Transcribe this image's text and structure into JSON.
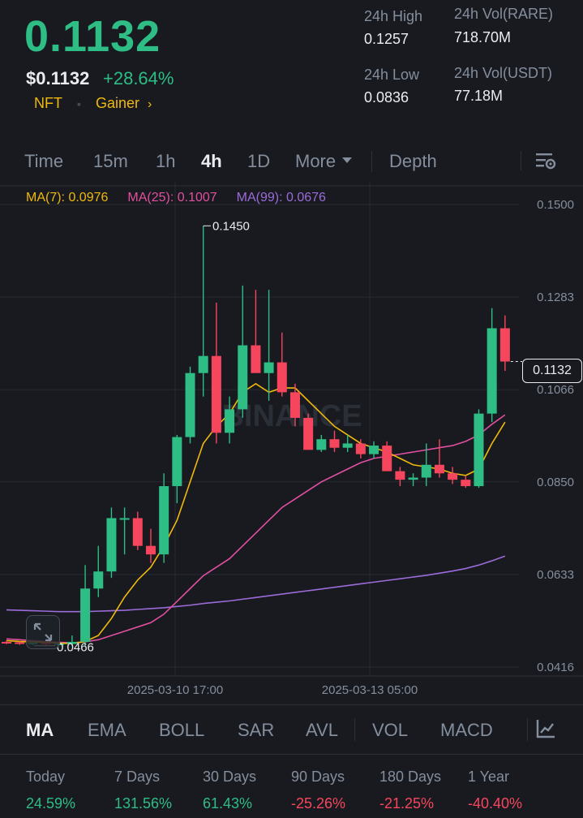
{
  "header": {
    "last_price": "0.1132",
    "price_usd": "$0.1132",
    "change_pct": "+28.64%",
    "tag_category": "NFT",
    "tag_rank": "Gainer",
    "high_label": "24h High",
    "high_value": "0.1257",
    "low_label": "24h Low",
    "low_value": "0.0836",
    "vol_base_label": "24h Vol(RARE)",
    "vol_base_value": "718.70M",
    "vol_quote_label": "24h Vol(USDT)",
    "vol_quote_value": "77.18M"
  },
  "intervals": {
    "time": "Time",
    "m15": "15m",
    "h1": "1h",
    "h4": "4h",
    "d1": "1D",
    "more": "More",
    "depth": "Depth"
  },
  "ma_legend": {
    "ma7": "MA(7): 0.0976",
    "ma25": "MA(25): 0.1007",
    "ma99": "MA(99): 0.0676"
  },
  "chart_data": {
    "type": "candlestick",
    "y_ticks": [
      "0.1500",
      "0.1283",
      "0.1066",
      "0.0850",
      "0.0633",
      "0.0416"
    ],
    "ylim": [
      0.0416,
      0.15
    ],
    "x_ticks": [
      "2025-03-10 17:00",
      "2025-03-13 05:00"
    ],
    "watermark": "BINANCE",
    "high_marker": "0.1450",
    "low_marker": "0.0466",
    "current_price": "0.1132",
    "candles": [
      {
        "o": 0.0475,
        "h": 0.0478,
        "l": 0.047,
        "c": 0.0474
      },
      {
        "o": 0.0474,
        "h": 0.0476,
        "l": 0.0468,
        "c": 0.0472
      },
      {
        "o": 0.0472,
        "h": 0.0475,
        "l": 0.0467,
        "c": 0.0473
      },
      {
        "o": 0.0473,
        "h": 0.0476,
        "l": 0.0466,
        "c": 0.047
      },
      {
        "o": 0.047,
        "h": 0.0474,
        "l": 0.0468,
        "c": 0.0471
      },
      {
        "o": 0.047,
        "h": 0.049,
        "l": 0.0466,
        "c": 0.0475
      },
      {
        "o": 0.0475,
        "h": 0.0655,
        "l": 0.0466,
        "c": 0.06
      },
      {
        "o": 0.06,
        "h": 0.07,
        "l": 0.058,
        "c": 0.064
      },
      {
        "o": 0.064,
        "h": 0.079,
        "l": 0.0625,
        "c": 0.0765
      },
      {
        "o": 0.0765,
        "h": 0.079,
        "l": 0.068,
        "c": 0.0765
      },
      {
        "o": 0.0765,
        "h": 0.078,
        "l": 0.069,
        "c": 0.07
      },
      {
        "o": 0.07,
        "h": 0.074,
        "l": 0.066,
        "c": 0.068
      },
      {
        "o": 0.068,
        "h": 0.087,
        "l": 0.066,
        "c": 0.084
      },
      {
        "o": 0.084,
        "h": 0.096,
        "l": 0.08,
        "c": 0.0955
      },
      {
        "o": 0.0955,
        "h": 0.112,
        "l": 0.094,
        "c": 0.1105
      },
      {
        "o": 0.1105,
        "h": 0.145,
        "l": 0.105,
        "c": 0.1145
      },
      {
        "o": 0.1145,
        "h": 0.127,
        "l": 0.094,
        "c": 0.0965
      },
      {
        "o": 0.0965,
        "h": 0.105,
        "l": 0.094,
        "c": 0.102
      },
      {
        "o": 0.102,
        "h": 0.131,
        "l": 0.1,
        "c": 0.117
      },
      {
        "o": 0.117,
        "h": 0.13,
        "l": 0.112,
        "c": 0.1105
      },
      {
        "o": 0.1105,
        "h": 0.13,
        "l": 0.104,
        "c": 0.113
      },
      {
        "o": 0.113,
        "h": 0.12,
        "l": 0.105,
        "c": 0.106
      },
      {
        "o": 0.106,
        "h": 0.108,
        "l": 0.098,
        "c": 0.1
      },
      {
        "o": 0.1,
        "h": 0.101,
        "l": 0.093,
        "c": 0.0925
      },
      {
        "o": 0.0925,
        "h": 0.096,
        "l": 0.092,
        "c": 0.095
      },
      {
        "o": 0.095,
        "h": 0.097,
        "l": 0.092,
        "c": 0.093
      },
      {
        "o": 0.093,
        "h": 0.096,
        "l": 0.092,
        "c": 0.094
      },
      {
        "o": 0.094,
        "h": 0.095,
        "l": 0.0905,
        "c": 0.0915
      },
      {
        "o": 0.0915,
        "h": 0.0945,
        "l": 0.0905,
        "c": 0.0935
      },
      {
        "o": 0.0935,
        "h": 0.0945,
        "l": 0.0885,
        "c": 0.0875
      },
      {
        "o": 0.0875,
        "h": 0.0885,
        "l": 0.084,
        "c": 0.0855
      },
      {
        "o": 0.0855,
        "h": 0.087,
        "l": 0.084,
        "c": 0.086
      },
      {
        "o": 0.086,
        "h": 0.094,
        "l": 0.084,
        "c": 0.089
      },
      {
        "o": 0.089,
        "h": 0.095,
        "l": 0.086,
        "c": 0.087
      },
      {
        "o": 0.087,
        "h": 0.0885,
        "l": 0.0845,
        "c": 0.0855
      },
      {
        "o": 0.0855,
        "h": 0.0865,
        "l": 0.0836,
        "c": 0.084
      },
      {
        "o": 0.084,
        "h": 0.102,
        "l": 0.0836,
        "c": 0.101
      },
      {
        "o": 0.101,
        "h": 0.1257,
        "l": 0.099,
        "c": 0.121
      },
      {
        "o": 0.121,
        "h": 0.124,
        "l": 0.111,
        "c": 0.1132
      }
    ],
    "ma7": [
      0.0478,
      0.0476,
      0.0475,
      0.0474,
      0.0472,
      0.0471,
      0.0476,
      0.049,
      0.053,
      0.058,
      0.062,
      0.065,
      0.07,
      0.076,
      0.085,
      0.094,
      0.098,
      0.101,
      0.106,
      0.108,
      0.106,
      0.107,
      0.107,
      0.104,
      0.101,
      0.098,
      0.096,
      0.094,
      0.093,
      0.092,
      0.0905,
      0.089,
      0.0885,
      0.088,
      0.087,
      0.0865,
      0.088,
      0.094,
      0.099
    ],
    "ma25": [
      0.0482,
      0.048,
      0.0478,
      0.0476,
      0.0474,
      0.0473,
      0.0475,
      0.048,
      0.049,
      0.05,
      0.051,
      0.052,
      0.054,
      0.057,
      0.06,
      0.063,
      0.065,
      0.067,
      0.07,
      0.073,
      0.076,
      0.079,
      0.081,
      0.083,
      0.085,
      0.0865,
      0.088,
      0.0895,
      0.0905,
      0.091,
      0.0915,
      0.092,
      0.0925,
      0.093,
      0.0935,
      0.0945,
      0.096,
      0.0985,
      0.1007
    ],
    "ma99": [
      0.055,
      0.0549,
      0.0548,
      0.0547,
      0.0546,
      0.0546,
      0.0546,
      0.0547,
      0.0548,
      0.0549,
      0.0551,
      0.0553,
      0.0555,
      0.0558,
      0.0561,
      0.0565,
      0.0568,
      0.0571,
      0.0575,
      0.0579,
      0.0583,
      0.0587,
      0.0591,
      0.0595,
      0.0599,
      0.0603,
      0.0607,
      0.0611,
      0.0615,
      0.0619,
      0.0623,
      0.0627,
      0.0631,
      0.0636,
      0.0641,
      0.0647,
      0.0655,
      0.0665,
      0.0676
    ]
  },
  "indicators": {
    "ma": "MA",
    "ema": "EMA",
    "boll": "BOLL",
    "sar": "SAR",
    "avl": "AVL",
    "vol": "VOL",
    "macd": "MACD"
  },
  "performance": [
    {
      "label": "Today",
      "value": "24.59%",
      "dir": "up"
    },
    {
      "label": "7 Days",
      "value": "131.56%",
      "dir": "up"
    },
    {
      "label": "30 Days",
      "value": "61.43%",
      "dir": "up"
    },
    {
      "label": "90 Days",
      "value": "-25.26%",
      "dir": "down"
    },
    {
      "label": "180 Days",
      "value": "-21.25%",
      "dir": "down"
    },
    {
      "label": "1 Year",
      "value": "-40.40%",
      "dir": "down"
    }
  ],
  "colors": {
    "up": "#2ebd85",
    "down": "#f6465d",
    "ma7": "#f0b90b",
    "ma25": "#e14fa0",
    "ma99": "#9b6bd8",
    "accent": "#f0b90b"
  }
}
